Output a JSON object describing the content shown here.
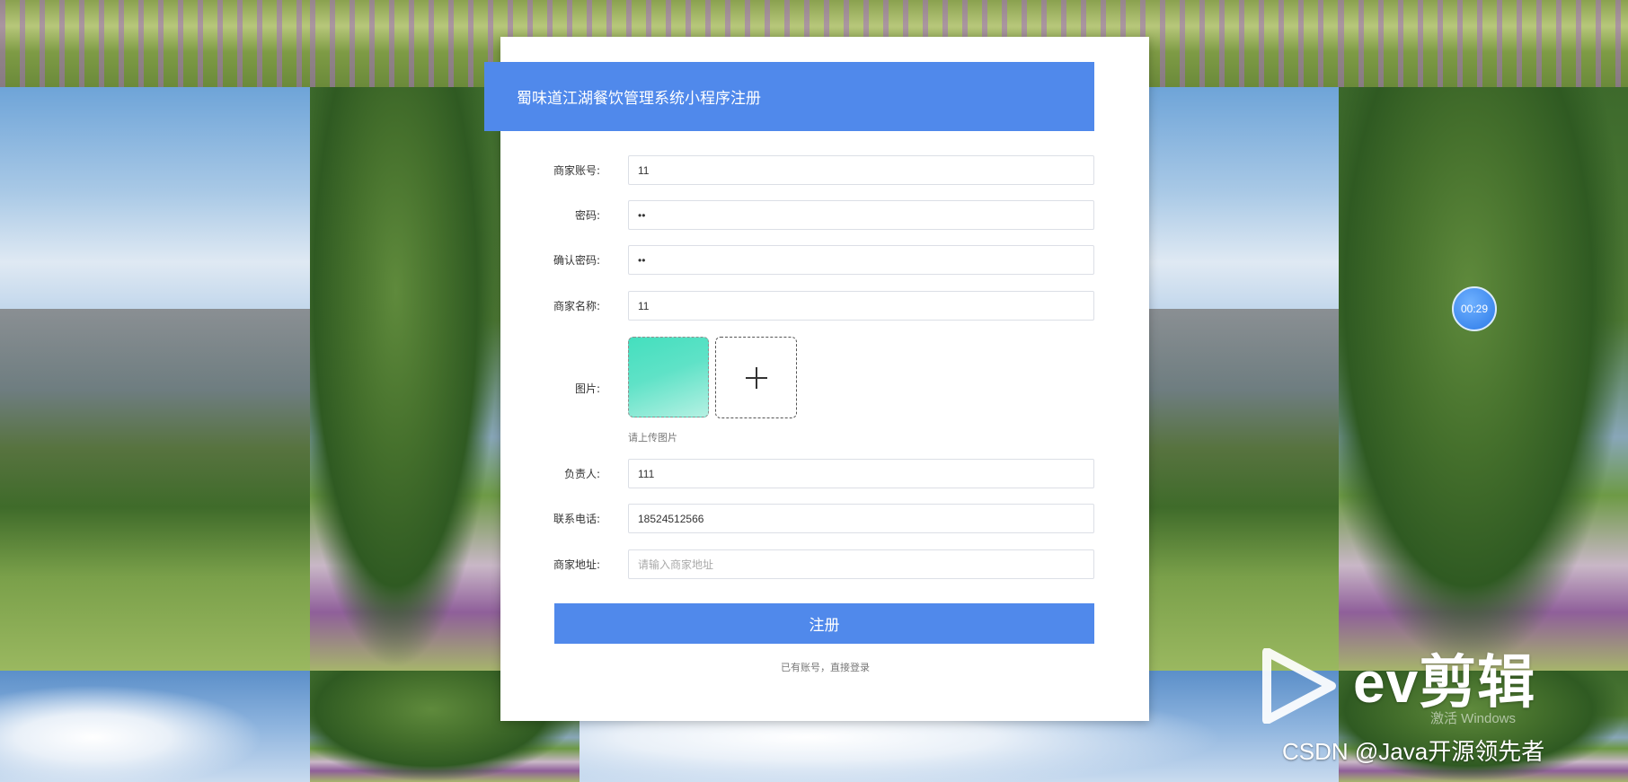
{
  "header": {
    "title": "蜀味道江湖餐饮管理系统小程序注册"
  },
  "form": {
    "fields": [
      {
        "label": "商家账号:",
        "value": "11",
        "type": "text"
      },
      {
        "label": "密码:",
        "value": "••",
        "type": "password"
      },
      {
        "label": "确认密码:",
        "value": "••",
        "type": "password"
      },
      {
        "label": "商家名称:",
        "value": "11",
        "type": "text"
      },
      {
        "label": "负责人:",
        "value": "111",
        "type": "text"
      },
      {
        "label": "联系电话:",
        "value": "18524512566",
        "type": "text"
      },
      {
        "label": "商家地址:",
        "value": "",
        "placeholder": "请输入商家地址",
        "type": "text"
      }
    ],
    "image_label": "图片:",
    "image_hint": "请上传图片",
    "submit_label": "注册",
    "login_link": "已有账号，直接登录"
  },
  "overlay": {
    "timer": "00:29",
    "ev_brand": "ev剪辑",
    "windows_watermark": "激活 Windows",
    "csdn_watermark": "CSDN @Java开源领先者"
  },
  "colors": {
    "primary": "#5089eb",
    "thumbnail": "#4fe1c2"
  },
  "icons": {
    "upload": "plus-icon",
    "ev_logo": "play-triangle-icon"
  }
}
